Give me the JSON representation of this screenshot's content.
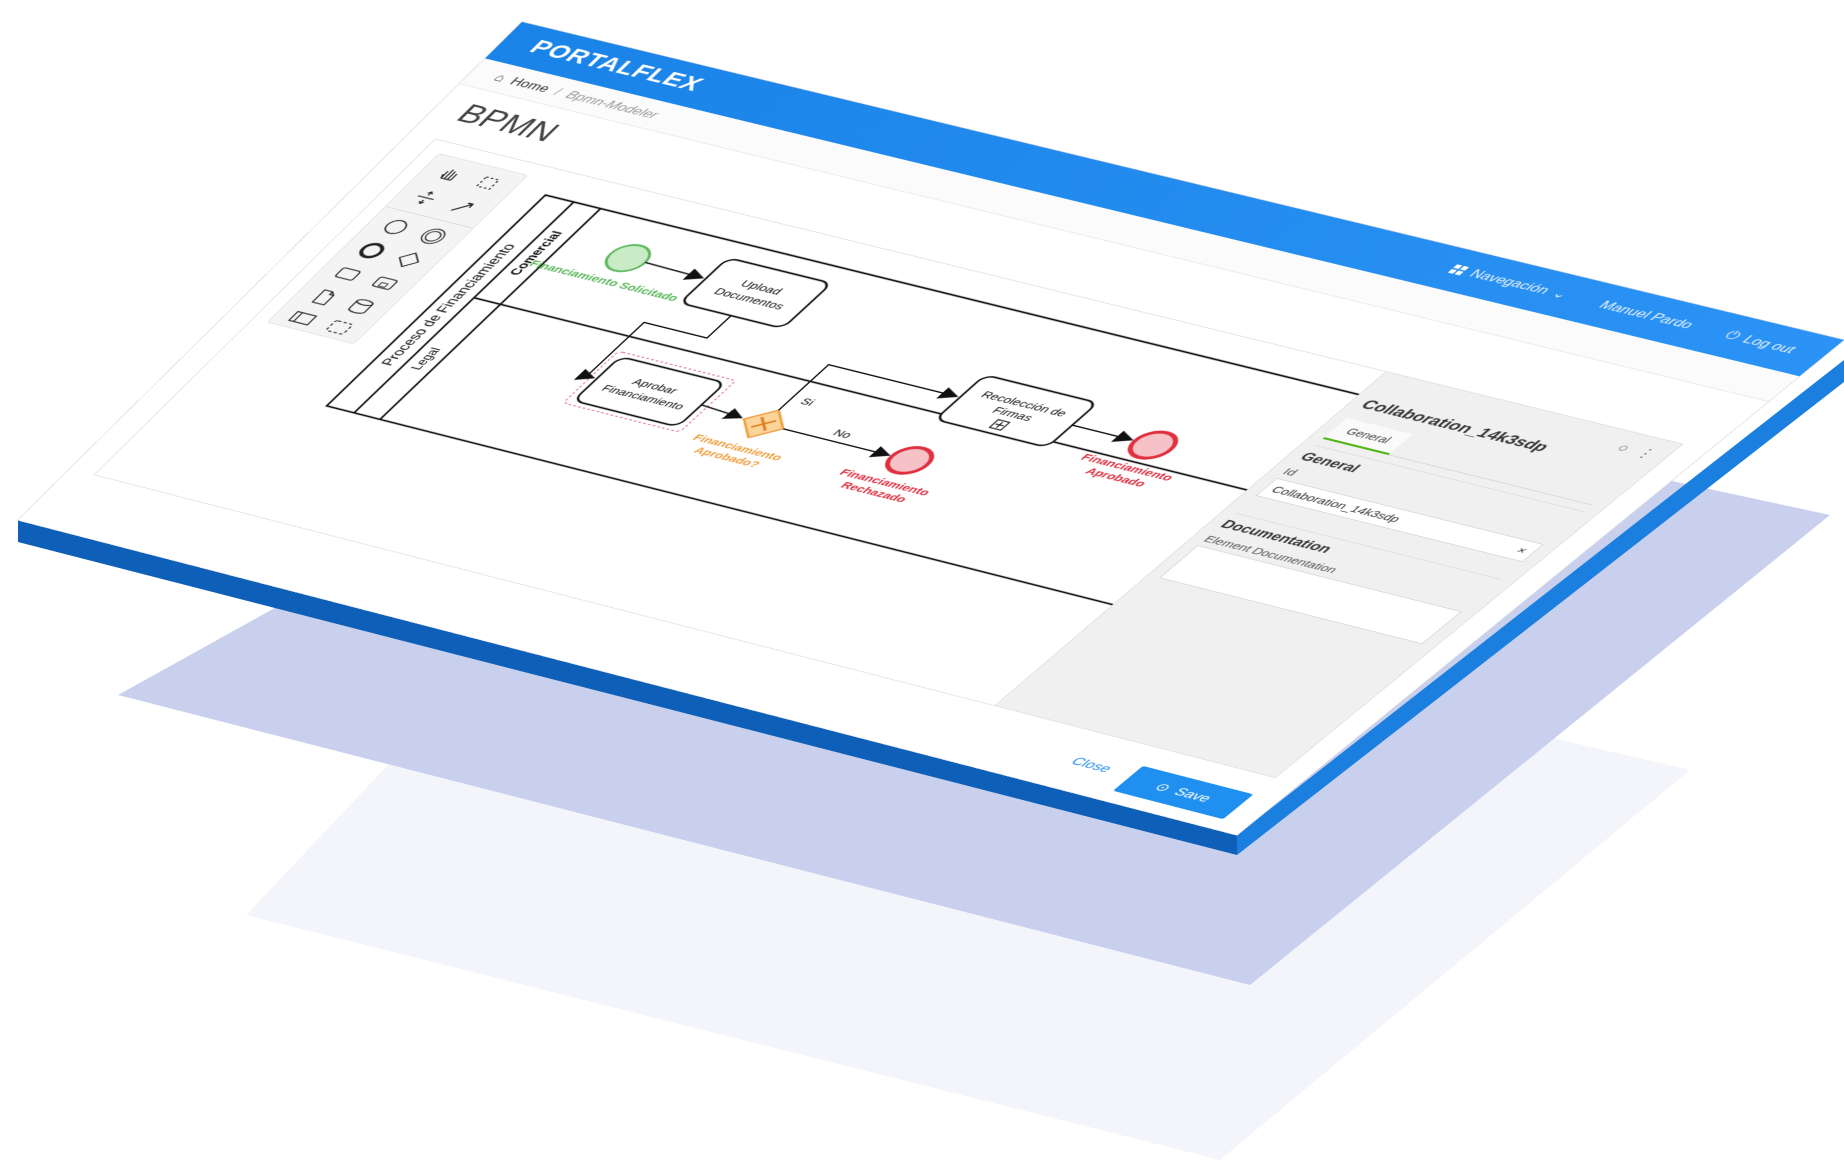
{
  "app": {
    "brand": "PORTALFLEX",
    "nav": {
      "navigation_label": "Navegación",
      "user_name": "Manuel Pardo",
      "logout_label": "Log out"
    }
  },
  "breadcrumb": {
    "home": "Home",
    "separator": "/",
    "current": "Bpmn-Modeler"
  },
  "page": {
    "title": "BPMN"
  },
  "diagram": {
    "pool_label": "Proceso de Financiamiento",
    "lanes": [
      "Comercial",
      "Legal"
    ],
    "start_event": "Financiamiento Solicitado",
    "task_upload": [
      "Upload",
      "Documentos"
    ],
    "task_approve": [
      "Aprobar",
      "Financiamiento"
    ],
    "task_signatures": [
      "Recolección de",
      "Firmas"
    ],
    "gateway": [
      "Financiamiento",
      "Aprobado?"
    ],
    "flow_yes": "Si",
    "flow_no": "No",
    "end_approved": [
      "Financiamiento",
      "Aprobado"
    ],
    "end_rejected": [
      "Financiamiento",
      "Rechazado"
    ]
  },
  "properties": {
    "title": "Collaboration_14k3sdp",
    "tab_general": "General",
    "group_general": "General",
    "id_label": "Id",
    "id_value": "Collaboration_14k3sdp",
    "clear_icon": "×",
    "group_documentation": "Documentation",
    "doc_label": "Element Documentation"
  },
  "footer": {
    "close_label": "Close",
    "save_label": "Save"
  },
  "colors": {
    "accent": "#1a83e8",
    "start_event": "#5cb85c",
    "gateway": "#f0a040",
    "end_event": "#e03040",
    "layer_back": "#c9d0ed"
  }
}
